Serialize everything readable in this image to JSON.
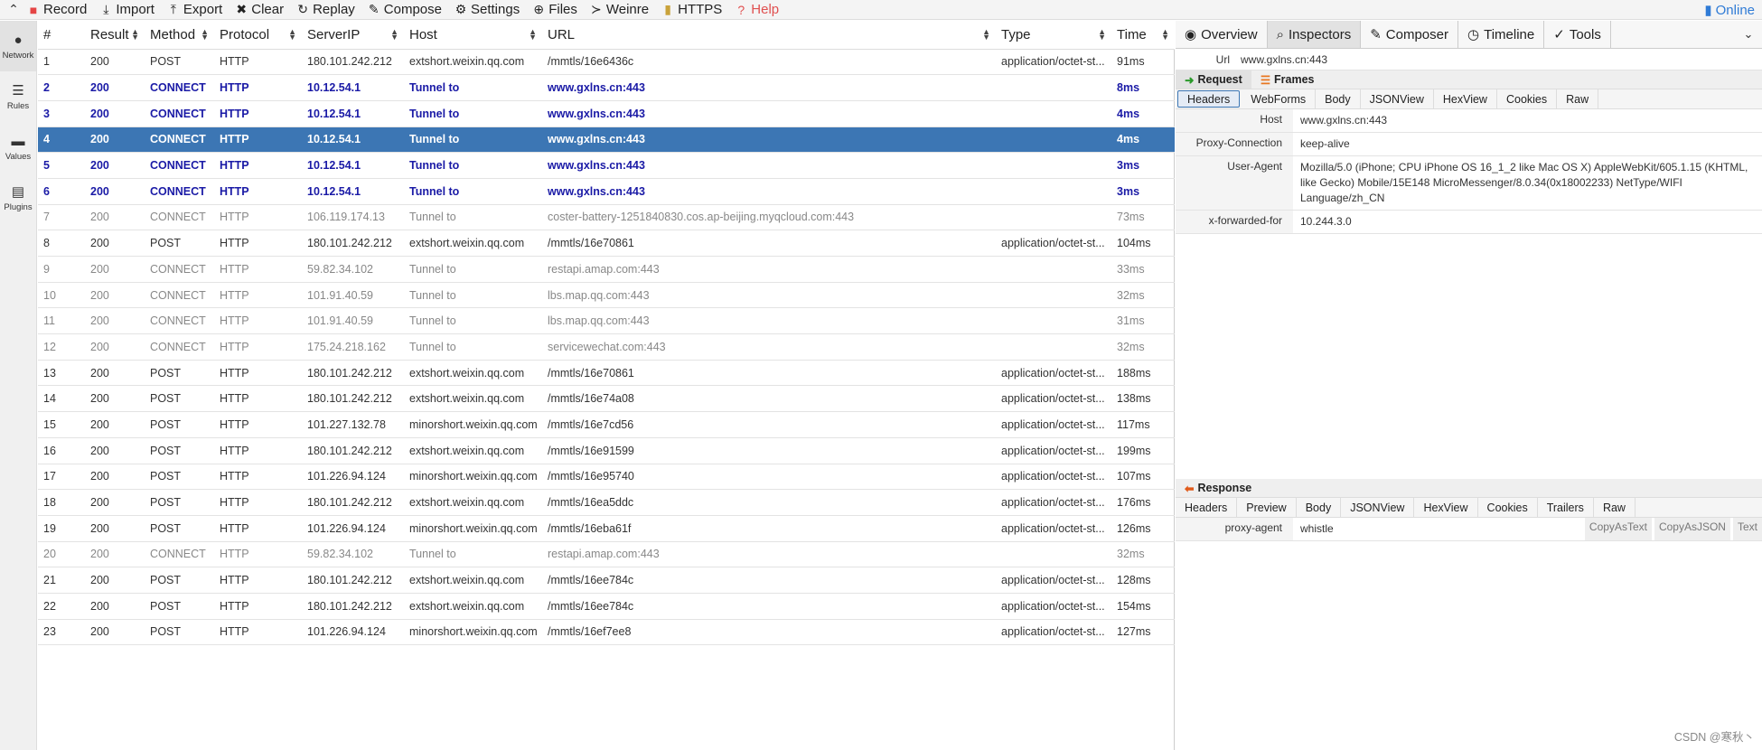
{
  "toolbar": {
    "items": [
      {
        "label": "Record"
      },
      {
        "label": "Import"
      },
      {
        "label": "Export"
      },
      {
        "label": "Clear"
      },
      {
        "label": "Replay"
      },
      {
        "label": "Compose"
      },
      {
        "label": "Settings"
      },
      {
        "label": "Files"
      },
      {
        "label": "Weinre"
      },
      {
        "label": "HTTPS"
      },
      {
        "label": "Help"
      }
    ],
    "online_label": "Online"
  },
  "leftnav": {
    "items": [
      {
        "label": "Network"
      },
      {
        "label": "Rules"
      },
      {
        "label": "Values"
      },
      {
        "label": "Plugins"
      }
    ]
  },
  "table": {
    "columns": [
      "#",
      "Result",
      "Method",
      "Protocol",
      "ServerIP",
      "Host",
      "URL",
      "Type",
      "Time"
    ],
    "rows": [
      [
        "1",
        "200",
        "POST",
        "HTTP",
        "180.101.242.212",
        "extshort.weixin.qq.com",
        "/mmtls/16e6436c",
        "application/octet-st...",
        "91ms"
      ],
      [
        "2",
        "200",
        "CONNECT",
        "HTTP",
        "10.12.54.1",
        "Tunnel to",
        "www.gxlns.cn:443",
        "",
        "8ms"
      ],
      [
        "3",
        "200",
        "CONNECT",
        "HTTP",
        "10.12.54.1",
        "Tunnel to",
        "www.gxlns.cn:443",
        "",
        "4ms"
      ],
      [
        "4",
        "200",
        "CONNECT",
        "HTTP",
        "10.12.54.1",
        "Tunnel to",
        "www.gxlns.cn:443",
        "",
        "4ms"
      ],
      [
        "5",
        "200",
        "CONNECT",
        "HTTP",
        "10.12.54.1",
        "Tunnel to",
        "www.gxlns.cn:443",
        "",
        "3ms"
      ],
      [
        "6",
        "200",
        "CONNECT",
        "HTTP",
        "10.12.54.1",
        "Tunnel to",
        "www.gxlns.cn:443",
        "",
        "3ms"
      ],
      [
        "7",
        "200",
        "CONNECT",
        "HTTP",
        "106.119.174.13",
        "Tunnel to",
        "coster-battery-1251840830.cos.ap-beijing.myqcloud.com:443",
        "",
        "73ms"
      ],
      [
        "8",
        "200",
        "POST",
        "HTTP",
        "180.101.242.212",
        "extshort.weixin.qq.com",
        "/mmtls/16e70861",
        "application/octet-st...",
        "104ms"
      ],
      [
        "9",
        "200",
        "CONNECT",
        "HTTP",
        "59.82.34.102",
        "Tunnel to",
        "restapi.amap.com:443",
        "",
        "33ms"
      ],
      [
        "10",
        "200",
        "CONNECT",
        "HTTP",
        "101.91.40.59",
        "Tunnel to",
        "lbs.map.qq.com:443",
        "",
        "32ms"
      ],
      [
        "11",
        "200",
        "CONNECT",
        "HTTP",
        "101.91.40.59",
        "Tunnel to",
        "lbs.map.qq.com:443",
        "",
        "31ms"
      ],
      [
        "12",
        "200",
        "CONNECT",
        "HTTP",
        "175.24.218.162",
        "Tunnel to",
        "servicewechat.com:443",
        "",
        "32ms"
      ],
      [
        "13",
        "200",
        "POST",
        "HTTP",
        "180.101.242.212",
        "extshort.weixin.qq.com",
        "/mmtls/16e70861",
        "application/octet-st...",
        "188ms"
      ],
      [
        "14",
        "200",
        "POST",
        "HTTP",
        "180.101.242.212",
        "extshort.weixin.qq.com",
        "/mmtls/16e74a08",
        "application/octet-st...",
        "138ms"
      ],
      [
        "15",
        "200",
        "POST",
        "HTTP",
        "101.227.132.78",
        "minorshort.weixin.qq.com",
        "/mmtls/16e7cd56",
        "application/octet-st...",
        "117ms"
      ],
      [
        "16",
        "200",
        "POST",
        "HTTP",
        "180.101.242.212",
        "extshort.weixin.qq.com",
        "/mmtls/16e91599",
        "application/octet-st...",
        "199ms"
      ],
      [
        "17",
        "200",
        "POST",
        "HTTP",
        "101.226.94.124",
        "minorshort.weixin.qq.com",
        "/mmtls/16e95740",
        "application/octet-st...",
        "107ms"
      ],
      [
        "18",
        "200",
        "POST",
        "HTTP",
        "180.101.242.212",
        "extshort.weixin.qq.com",
        "/mmtls/16ea5ddc",
        "application/octet-st...",
        "176ms"
      ],
      [
        "19",
        "200",
        "POST",
        "HTTP",
        "101.226.94.124",
        "minorshort.weixin.qq.com",
        "/mmtls/16eba61f",
        "application/octet-st...",
        "126ms"
      ],
      [
        "20",
        "200",
        "CONNECT",
        "HTTP",
        "59.82.34.102",
        "Tunnel to",
        "restapi.amap.com:443",
        "",
        "32ms"
      ],
      [
        "21",
        "200",
        "POST",
        "HTTP",
        "180.101.242.212",
        "extshort.weixin.qq.com",
        "/mmtls/16ee784c",
        "application/octet-st...",
        "128ms"
      ],
      [
        "22",
        "200",
        "POST",
        "HTTP",
        "180.101.242.212",
        "extshort.weixin.qq.com",
        "/mmtls/16ee784c",
        "application/octet-st...",
        "154ms"
      ],
      [
        "23",
        "200",
        "POST",
        "HTTP",
        "101.226.94.124",
        "minorshort.weixin.qq.com",
        "/mmtls/16ef7ee8",
        "application/octet-st...",
        "127ms"
      ]
    ],
    "row_styles": [
      "normal",
      "tunnel",
      "tunnel",
      "selected",
      "tunnel",
      "tunnel",
      "muted",
      "normal",
      "muted",
      "muted",
      "muted",
      "muted",
      "normal",
      "normal",
      "normal",
      "normal",
      "normal",
      "normal",
      "normal",
      "muted",
      "normal",
      "normal",
      "normal"
    ]
  },
  "inspector": {
    "tabs": [
      "Overview",
      "Inspectors",
      "Composer",
      "Timeline",
      "Tools"
    ],
    "active_tab": "Inspectors",
    "url_label": "Url",
    "url_value": "www.gxlns.cn:443",
    "request_label": "Request",
    "frames_label": "Frames",
    "request_subtabs": [
      "Headers",
      "WebForms",
      "Body",
      "JSONView",
      "HexView",
      "Cookies",
      "Raw"
    ],
    "request_headers": [
      {
        "key": "Host",
        "value": "www.gxlns.cn:443"
      },
      {
        "key": "Proxy-Connection",
        "value": "keep-alive"
      },
      {
        "key": "User-Agent",
        "value": "Mozilla/5.0 (iPhone; CPU iPhone OS 16_1_2 like Mac OS X) AppleWebKit/605.1.15 (KHTML, like Gecko) Mobile/15E148 MicroMessenger/8.0.34(0x18002233) NetType/WIFI Language/zh_CN"
      },
      {
        "key": "x-forwarded-for",
        "value": "10.244.3.0"
      }
    ],
    "response_label": "Response",
    "response_subtabs": [
      "Headers",
      "Preview",
      "Body",
      "JSONView",
      "HexView",
      "Cookies",
      "Trailers",
      "Raw"
    ],
    "response_headers": [
      {
        "key": "proxy-agent",
        "value": "whistle"
      }
    ],
    "response_actions": [
      "CopyAsText",
      "CopyAsJSON",
      "Text"
    ]
  },
  "watermark": "CSDN @寒秋丶",
  "colors": {
    "selected_row": "#3c76b4",
    "tunnel_text": "#1a1aa6",
    "help": "#e05050",
    "online": "#2f7bd6"
  }
}
